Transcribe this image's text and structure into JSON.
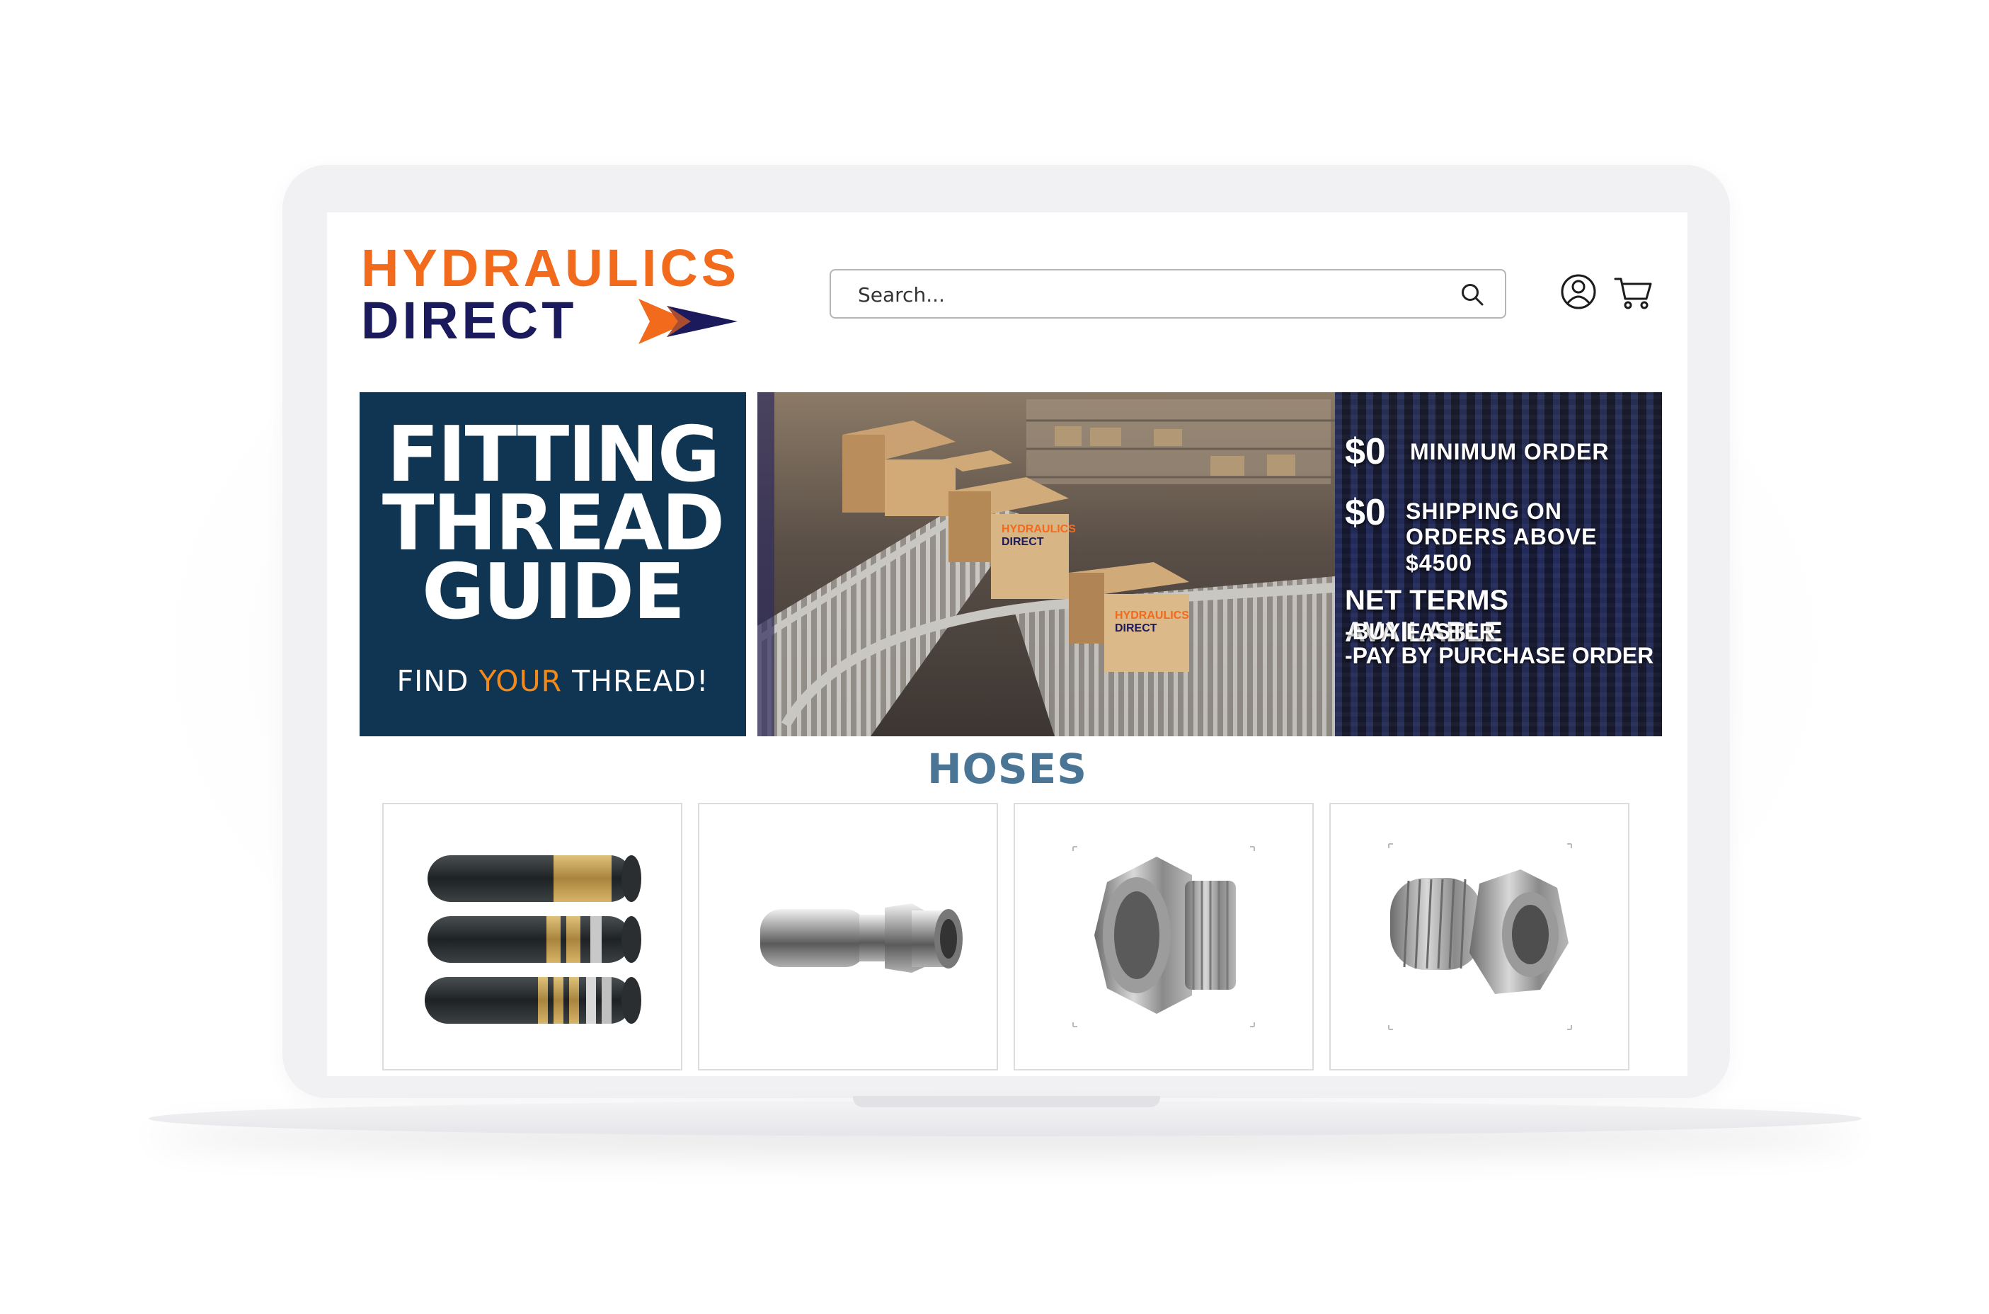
{
  "brand": {
    "line1": "HYDRAULICS",
    "line2": "DIRECT",
    "colors": {
      "orange": "#f26a1b",
      "navy": "#1a1a5c"
    }
  },
  "header": {
    "search": {
      "placeholder": "Search..."
    },
    "icons": [
      "search-icon",
      "account-icon",
      "cart-icon"
    ]
  },
  "banners": {
    "thread_guide": {
      "title_lines": [
        "FITTING",
        "THREAD",
        "GUIDE"
      ],
      "subtitle_before": "FIND ",
      "subtitle_accent": "YOUR",
      "subtitle_after": " THREAD!",
      "background": "#0f3552"
    },
    "promo": {
      "min_amount": "$0",
      "min_label": "MINIMUM ORDER",
      "ship_amount": "$0",
      "ship_label_1": "SHIPPING ON",
      "ship_label_2": "ORDERS ABOVE $4500",
      "net_title": "NET TERMS AVAILABLE",
      "net_item_1": "-BUY FASTER",
      "net_item_2": "-PAY BY PURCHASE ORDER"
    },
    "warehouse": {
      "box_label_1": "HYDRAULICS",
      "box_label_2": "DIRECT"
    }
  },
  "section": {
    "title": "HOSES",
    "title_color": "#4b7595",
    "products": [
      {
        "image": "hydraulic-hose-image"
      },
      {
        "image": "hose-fitting-image"
      },
      {
        "image": "hex-bushing-image"
      },
      {
        "image": "reducer-bushing-image"
      }
    ]
  }
}
